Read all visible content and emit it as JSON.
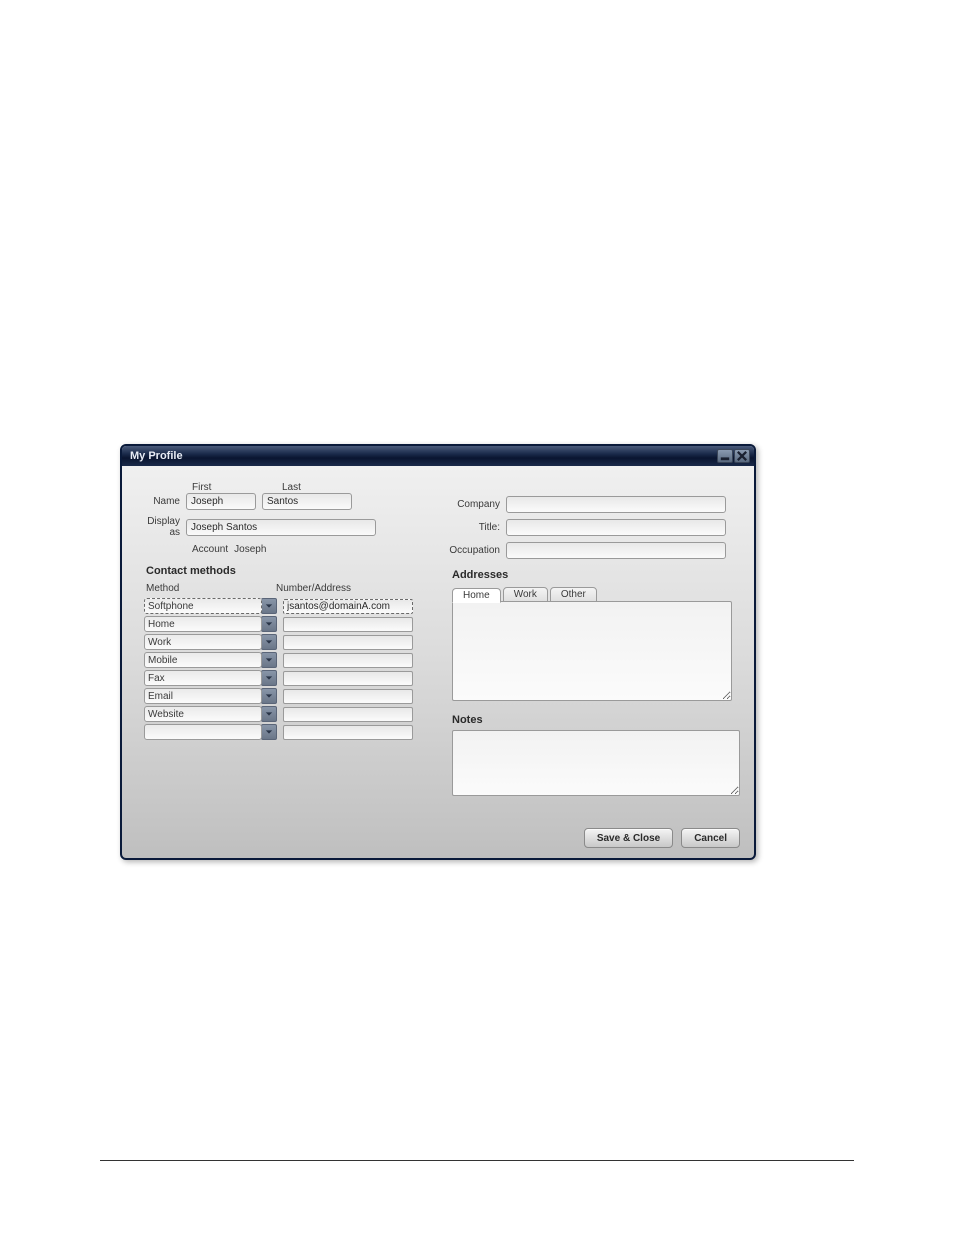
{
  "window": {
    "title": "My Profile"
  },
  "name": {
    "first_header": "First",
    "last_header": "Last",
    "label": "Name",
    "first_value": "Joseph",
    "last_value": "Santos"
  },
  "display_as": {
    "label": "Display as",
    "value": "Joseph Santos"
  },
  "account": {
    "label": "Account",
    "value": "Joseph"
  },
  "contact_methods": {
    "title": "Contact methods",
    "method_header": "Method",
    "address_header": "Number/Address",
    "rows": [
      {
        "method": "Softphone",
        "value": "jsantos@domainA.com"
      },
      {
        "method": "Home",
        "value": ""
      },
      {
        "method": "Work",
        "value": ""
      },
      {
        "method": "Mobile",
        "value": ""
      },
      {
        "method": "Fax",
        "value": ""
      },
      {
        "method": "Email",
        "value": ""
      },
      {
        "method": "Website",
        "value": ""
      },
      {
        "method": "",
        "value": ""
      }
    ]
  },
  "right": {
    "company_label": "Company",
    "company_value": "",
    "title_label": "Title:",
    "title_value": "",
    "occupation_label": "Occupation",
    "occupation_value": ""
  },
  "addresses": {
    "title": "Addresses",
    "tabs": {
      "home": "Home",
      "work": "Work",
      "other": "Other"
    },
    "home_value": "",
    "active": "home"
  },
  "notes": {
    "title": "Notes",
    "value": ""
  },
  "buttons": {
    "save": "Save & Close",
    "cancel": "Cancel"
  }
}
